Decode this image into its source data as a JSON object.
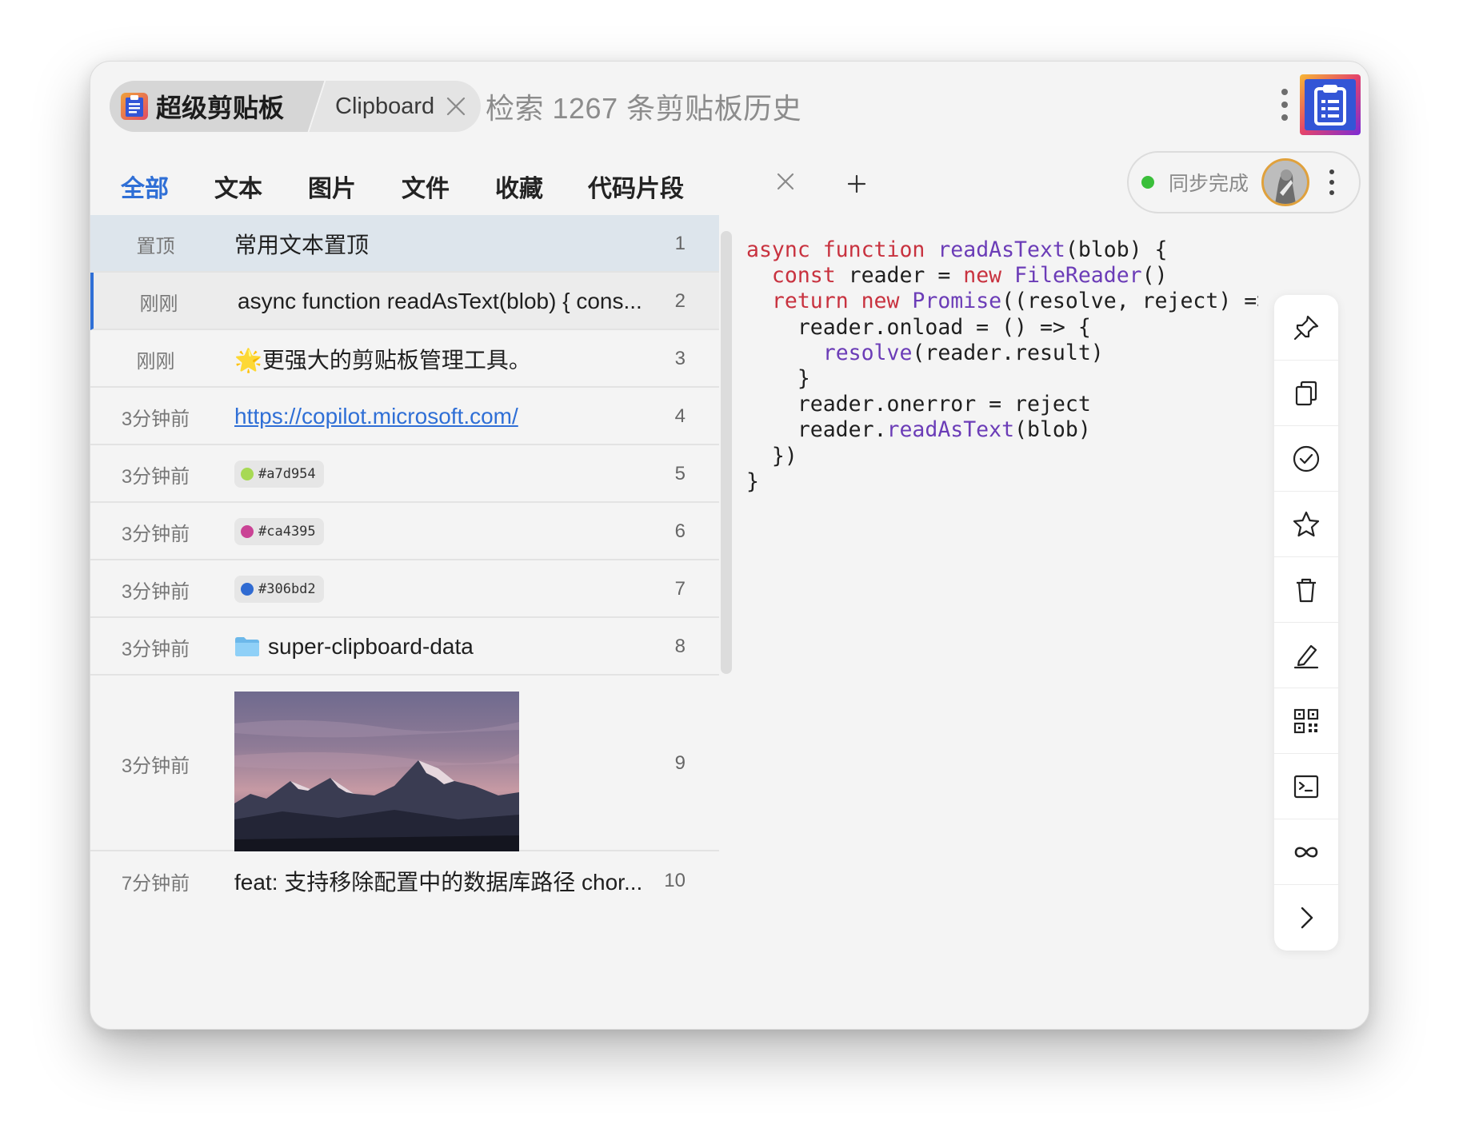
{
  "header": {
    "app_name": "超级剪贴板",
    "tab_label": "Clipboard",
    "search_placeholder": "检索 1267 条剪贴板历史"
  },
  "tabs": [
    {
      "label": "全部",
      "active": true
    },
    {
      "label": "文本"
    },
    {
      "label": "图片"
    },
    {
      "label": "文件"
    },
    {
      "label": "收藏"
    },
    {
      "label": "代码片段"
    }
  ],
  "sync": {
    "label": "同步完成",
    "status_color": "#3bbf3b"
  },
  "list": [
    {
      "time": "置顶",
      "content": "常用文本置顶",
      "index": "1"
    },
    {
      "time": "刚刚",
      "content": "async function readAsText(blob) { cons...",
      "index": "2"
    },
    {
      "time": "刚刚",
      "content": "🌟更强大的剪贴板管理工具。",
      "index": "3"
    },
    {
      "time": "3分钟前",
      "content": "https://copilot.microsoft.com/",
      "index": "4"
    },
    {
      "time": "3分钟前",
      "content": "#a7d954",
      "index": "5",
      "color": "#a7d954"
    },
    {
      "time": "3分钟前",
      "content": "#ca4395",
      "index": "6",
      "color": "#ca4395"
    },
    {
      "time": "3分钟前",
      "content": "#306bd2",
      "index": "7",
      "color": "#306bd2"
    },
    {
      "time": "3分钟前",
      "content": "super-clipboard-data",
      "index": "8"
    },
    {
      "time": "3分钟前",
      "content": "",
      "index": "9"
    },
    {
      "time": "7分钟前",
      "content": "feat: 支持移除配置中的数据库路径 chor...",
      "index": "10"
    }
  ],
  "code": {
    "lines": [
      [
        "async function ",
        "readAsText",
        "(blob) {"
      ],
      [
        "  const ",
        "",
        "reader = "
      ],
      [
        "  return new ",
        "Promise",
        "((resolve, reject) => {"
      ],
      [
        "    reader.onload = () => {"
      ],
      [
        "      ",
        "resolve",
        "(reader.result)"
      ],
      [
        "    }"
      ],
      [
        "    reader.onerror = reject"
      ],
      [
        "    reader.",
        "readAsText",
        "(blob)"
      ],
      [
        "  })"
      ],
      [
        "}"
      ]
    ]
  },
  "actions": [
    "pin-icon",
    "copy-icon",
    "check-circle-icon",
    "star-icon",
    "trash-icon",
    "edit-icon",
    "qr-code-icon",
    "terminal-icon",
    "infinity-icon",
    "chevron-right-icon"
  ]
}
